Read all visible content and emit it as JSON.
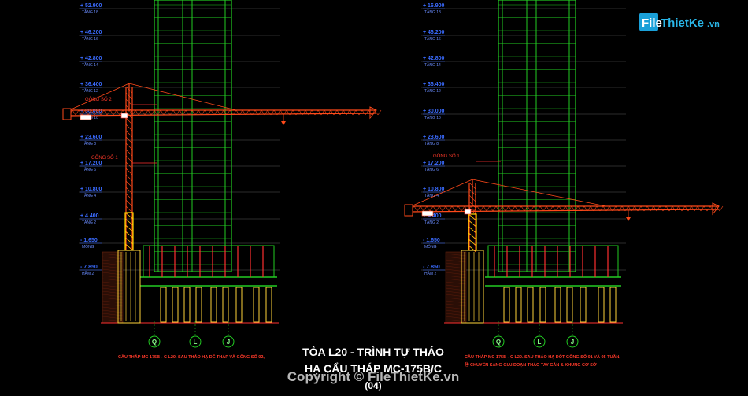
{
  "title": {
    "line1": "TÒA L20 - TRÌNH TỰ THÁO",
    "line2": "HẠ CẨU THÁP MC-175B/C",
    "line3": "(04)"
  },
  "watermark": "Copyright © FileThietKe.vn",
  "logo": {
    "text": "FileThietKe.vn",
    "first": "File",
    "rest": "ThietKe",
    "tld": ".vn"
  },
  "left_drawing": {
    "levels": [
      {
        "value": "+ 52.900",
        "label": "TẦNG 18"
      },
      {
        "value": "+ 46.200",
        "label": "TẦNG 16"
      },
      {
        "value": "+ 42.800",
        "label": "TẦNG 14"
      },
      {
        "value": "+ 36.400",
        "label": "TẦNG 12"
      },
      {
        "value": "+ 30.000",
        "label": "TẦNG 10"
      },
      {
        "value": "+ 23.600",
        "label": "TẦNG 8"
      },
      {
        "value": "+ 17.200",
        "label": "TẦNG 6"
      },
      {
        "value": "+ 10.800",
        "label": "TẦNG 4"
      },
      {
        "value": "+ 4.400",
        "label": "TẦNG 2"
      },
      {
        "value": "- 1.650",
        "label": "MÓNG"
      },
      {
        "value": "- 7.850",
        "label": "HẦM 2"
      }
    ],
    "tie_labels": [
      "GÔNG SỐ 2",
      "GÔNG SỐ 1"
    ],
    "axes": [
      "Q",
      "L",
      "J"
    ],
    "note": "CẦU THÁP MC 175B - C L20. SAU THÁO HẠ ĐẾ THÁP VÀ GÔNG SỐ 02,"
  },
  "right_drawing": {
    "levels": [
      {
        "value": "+ 16.900",
        "label": "TẦNG 18"
      },
      {
        "value": "+ 46.200",
        "label": "TẦNG 16"
      },
      {
        "value": "+ 42.800",
        "label": "TẦNG 14"
      },
      {
        "value": "+ 36.400",
        "label": "TẦNG 12"
      },
      {
        "value": "+ 30.000",
        "label": "TẦNG 10"
      },
      {
        "value": "+ 23.600",
        "label": "TẦNG 8"
      },
      {
        "value": "+ 17.200",
        "label": "TẦNG 6"
      },
      {
        "value": "+ 10.800",
        "label": "TẦNG 4"
      },
      {
        "value": "+ 4.400",
        "label": "TẦNG 2"
      },
      {
        "value": "- 1.650",
        "label": "MÓNG"
      },
      {
        "value": "- 7.850",
        "label": "HẦM 2"
      }
    ],
    "tie_labels": [
      "GÔNG SỐ 1"
    ],
    "axes": [
      "Q",
      "L",
      "J"
    ],
    "note": "CẦU THÁP MC 175B - C L20. SAU THÁO HẠ ĐỐT GÔNG SỐ 01 VÀ 05 TUẦN,",
    "note2": "Ⓜ CHUYỂN SANG GIAI ĐOẠN THÁO TAY CẦN & KHUNG CƠ SỞ"
  },
  "colors": {
    "building": "#22cc22",
    "crane": "#ff4a1a",
    "mast_base": "#ffe000",
    "level_text": "#3a6bff",
    "note_text": "#ff2a2a",
    "foundation": "#ffd43a",
    "pile_red": "#ff3030"
  }
}
